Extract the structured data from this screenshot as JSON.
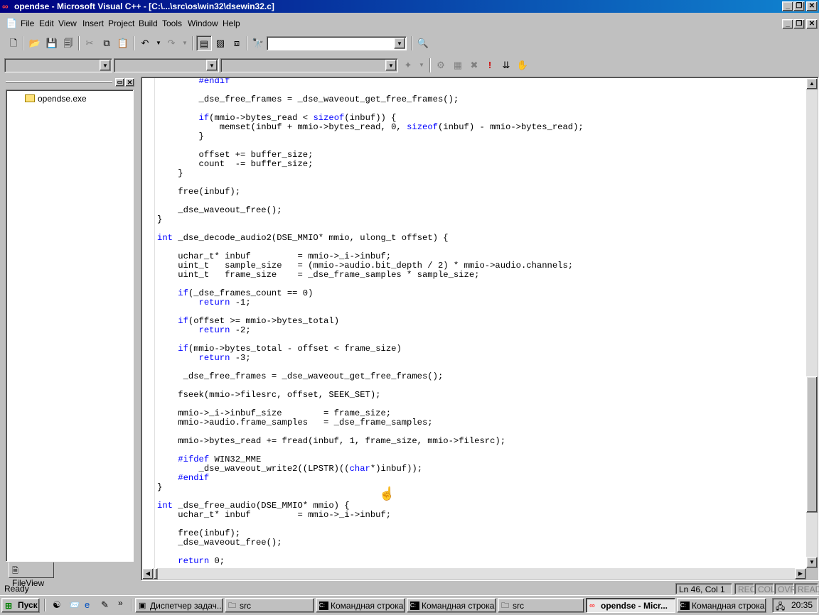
{
  "window": {
    "title": "opendse - Microsoft Visual C++ - [C:\\...\\src\\os\\win32\\dsewin32.c]",
    "minimize": "_",
    "maximize": "❐",
    "close": "✕"
  },
  "menu": {
    "items": [
      "File",
      "Edit",
      "View",
      "Insert",
      "Project",
      "Build",
      "Tools",
      "Window",
      "Help"
    ]
  },
  "toolbar": {
    "find_combo_value": "",
    "icons": [
      "new-text-file-icon",
      "open-folder-icon",
      "save-icon",
      "save-all-icon",
      "cut-icon",
      "copy-icon",
      "paste-icon",
      "undo-icon",
      "redo-icon",
      "workspace-icon",
      "output-icon",
      "window-list-icon",
      "find-in-files-icon",
      "find-icon"
    ],
    "wizard_combos": [
      "",
      "",
      ""
    ],
    "build_icons": [
      "compile-icon",
      "build-icon",
      "stop-build-icon",
      "execute-icon",
      "go-icon",
      "insert-breakpoint-icon"
    ]
  },
  "workspace": {
    "tree_items": [
      "opendse.exe"
    ],
    "tab_label": "FileView"
  },
  "editor": {
    "code_lines": [
      "        #endif",
      "",
      "        _dse_free_frames = _dse_waveout_get_free_frames();",
      "",
      "        if(mmio->bytes_read < sizeof(inbuf)) {",
      "            memset(inbuf + mmio->bytes_read, 0, sizeof(inbuf) - mmio->bytes_read);",
      "        }",
      "",
      "        offset += buffer_size;",
      "        count  -= buffer_size;",
      "    }",
      "",
      "    free(inbuf);",
      "",
      "    _dse_waveout_free();",
      "}",
      "",
      "int _dse_decode_audio2(DSE_MMIO* mmio, ulong_t offset) {",
      "",
      "    uchar_t* inbuf         = mmio->_i->inbuf;",
      "    uint_t   sample_size   = (mmio->audio.bit_depth / 2) * mmio->audio.channels;",
      "    uint_t   frame_size    = _dse_frame_samples * sample_size;",
      "",
      "    if(_dse_frames_count == 0)",
      "        return -1;",
      "",
      "    if(offset >= mmio->bytes_total)",
      "        return -2;",
      "",
      "    if(mmio->bytes_total - offset < frame_size)",
      "        return -3;",
      "",
      "     _dse_free_frames = _dse_waveout_get_free_frames();",
      "",
      "    fseek(mmio->filesrc, offset, SEEK_SET);",
      "",
      "    mmio->_i->inbuf_size        = frame_size;",
      "    mmio->audio.frame_samples   = _dse_frame_samples;",
      "",
      "    mmio->bytes_read += fread(inbuf, 1, frame_size, mmio->filesrc);",
      "",
      "    #ifdef WIN32_MME",
      "        _dse_waveout_write2((LPSTR)((char*)inbuf));",
      "    #endif",
      "}",
      "",
      "int _dse_free_audio(DSE_MMIO* mmio) {",
      "    uchar_t* inbuf         = mmio->_i->inbuf;",
      "",
      "    free(inbuf);",
      "    _dse_waveout_free();",
      "",
      "    return 0;"
    ],
    "keywords": [
      "#endif",
      "#ifdef",
      "int",
      "if",
      "sizeof",
      "return",
      "char"
    ]
  },
  "statusbar": {
    "status": "Ready",
    "position": "Ln 46, Col 1",
    "indicators": [
      "REC",
      "COL",
      "OVR",
      "READ"
    ]
  },
  "taskbar": {
    "start_label": "Пуск",
    "tasks": [
      {
        "label": "Диспетчер задач...",
        "icon": "task-manager-icon",
        "active": false
      },
      {
        "label": "src",
        "icon": "folder-icon",
        "active": false
      },
      {
        "label": "Командная строка",
        "icon": "cmd-icon",
        "active": false
      },
      {
        "label": "Командная строка",
        "icon": "cmd-icon",
        "active": false
      },
      {
        "label": "src",
        "icon": "folder-icon",
        "active": false
      },
      {
        "label": "opendse - Micr...",
        "icon": "msvc-icon",
        "active": true
      },
      {
        "label": "Командная строка",
        "icon": "cmd-icon",
        "active": false
      }
    ],
    "clock": "20:35"
  },
  "colors": {
    "titlebar_start": "#000080",
    "titlebar_end": "#1084d0",
    "keyword": "#0000ff",
    "face": "#c0c0c0"
  }
}
